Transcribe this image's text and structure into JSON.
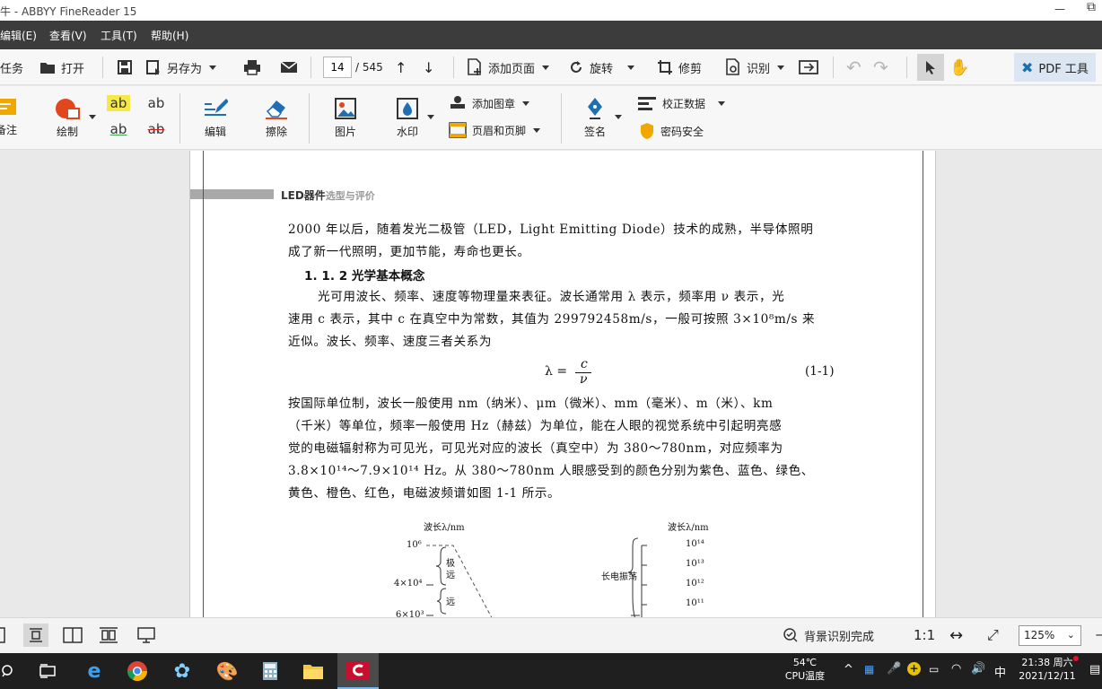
{
  "titlebar": {
    "title": "牛 - ABBYY FineReader 15"
  },
  "menu": {
    "edit": "编辑(E)",
    "view": "查看(V)",
    "tools": "工具(T)",
    "help": "帮助(H)"
  },
  "toolbar": {
    "task": "任务",
    "open": "打开",
    "save_as": "另存为",
    "page_current": "14",
    "page_total": "/ 545",
    "add_page": "添加页面",
    "rotate": "旋转",
    "crop": "修剪",
    "recognize": "识别",
    "pdf_tools": "PDF 工具"
  },
  "ribbon": {
    "note": "备注",
    "draw": "绘制",
    "edit": "编辑",
    "erase": "擦除",
    "image": "图片",
    "watermark": "水印",
    "add_stamp": "添加图章",
    "header_footer": "页眉和页脚",
    "sign": "签名",
    "redact": "校正数据",
    "password": "密码安全",
    "ab": "ab"
  },
  "document": {
    "header_main": "LED器件",
    "header_sub": "选型与评价",
    "para1": [
      "2000 年以后，随着发光二极管（LED，Light Emitting Diode）技术的成熟，半导体照明",
      "成了新一代照明，更加节能，寿命也更长。"
    ],
    "heading": "1. 1. 2    光学基本概念",
    "para2": [
      "光可用波长、频率、速度等物理量来表征。波长通常用 λ 表示，频率用 ν 表示，光",
      "速用 c 表示，其中 c 在真空中为常数，其值为 299792458m/s，一般可按照 3×10⁸m/s 来",
      "近似。波长、频率、速度三者关系为"
    ],
    "formula_lhs": "λ =",
    "formula_num": "c",
    "formula_den": "ν",
    "formula_label": "(1-1)",
    "para3": [
      "按国际单位制，波长一般使用 nm（纳米）、μm（微米）、mm（毫米）、m（米）、km",
      "（千米）等单位，频率一般使用 Hz（赫兹）为单位，能在人眼的视觉系统中引起明亮感",
      "觉的电磁辐射称为可见光，可见光对应的波长（真空中）为 380～780nm，对应频率为",
      "3.8×10¹⁴～7.9×10¹⁴ Hz。从 380～780nm 人眼感受到的颜色分别为紫色、蓝色、绿色、",
      "黄色、橙色、红色，电磁波频谱如图 1-1 所示。"
    ],
    "fig_left_title": "波长λ/nm",
    "fig_left_t1": "10⁶",
    "fig_left_t2": "4×10⁴",
    "fig_left_t3": "6×10³",
    "fig_left_l1a": "极",
    "fig_left_l1b": "远",
    "fig_left_l2": "远",
    "fig_right_title": "波长λ/nm",
    "fig_right_t1": "10¹⁴",
    "fig_right_t2": "10¹³",
    "fig_right_t3": "10¹²",
    "fig_right_t4": "10¹¹",
    "fig_right_label": "长电振荡"
  },
  "status": {
    "recognition": "背景识别完成",
    "ratio": "1:1",
    "zoom": "125%"
  },
  "taskbar": {
    "temp": "54℃",
    "temp_label": "CPU温度",
    "ime": "中",
    "time": "21:38 周六",
    "date": "2021/12/11"
  }
}
